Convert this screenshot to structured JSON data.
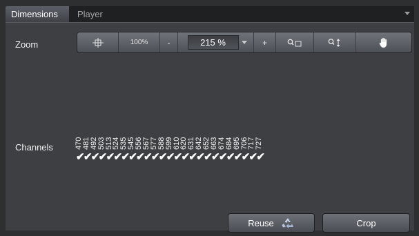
{
  "tabs": [
    {
      "label": "Dimensions",
      "active": true
    },
    {
      "label": "Player",
      "active": false
    }
  ],
  "zoom": {
    "label": "Zoom",
    "fit_icon": "fit-to-window-icon",
    "percent100_label": "100%",
    "minus_label": "-",
    "value": "215 %",
    "plus_label": "+",
    "zoom_rect_icon": "zoom-rectangle-icon",
    "zoom_vertical_icon": "zoom-vertical-icon",
    "pan_icon": "hand-pan-icon"
  },
  "channels": {
    "label": "Channels",
    "items": [
      {
        "name": "470",
        "checked": true
      },
      {
        "name": "481",
        "checked": true
      },
      {
        "name": "492",
        "checked": true
      },
      {
        "name": "503",
        "checked": true
      },
      {
        "name": "513",
        "checked": true
      },
      {
        "name": "524",
        "checked": true
      },
      {
        "name": "535",
        "checked": true
      },
      {
        "name": "545",
        "checked": true
      },
      {
        "name": "556",
        "checked": true
      },
      {
        "name": "567",
        "checked": true
      },
      {
        "name": "577",
        "checked": true
      },
      {
        "name": "588",
        "checked": true
      },
      {
        "name": "599",
        "checked": true
      },
      {
        "name": "610",
        "checked": true
      },
      {
        "name": "620",
        "checked": true
      },
      {
        "name": "631",
        "checked": true
      },
      {
        "name": "642",
        "checked": true
      },
      {
        "name": "652",
        "checked": true
      },
      {
        "name": "663",
        "checked": true
      },
      {
        "name": "674",
        "checked": true
      },
      {
        "name": "684",
        "checked": true
      },
      {
        "name": "695",
        "checked": true
      },
      {
        "name": "706",
        "checked": true
      },
      {
        "name": "717",
        "checked": true
      },
      {
        "name": "727",
        "checked": true
      }
    ]
  },
  "buttons": {
    "reuse_label": "Reuse",
    "reuse_icon": "recycle-icon",
    "crop_label": "Crop"
  },
  "colors": {
    "background": "#3d3f43",
    "tab_active": "#5d6068",
    "button": "#5e6168"
  }
}
